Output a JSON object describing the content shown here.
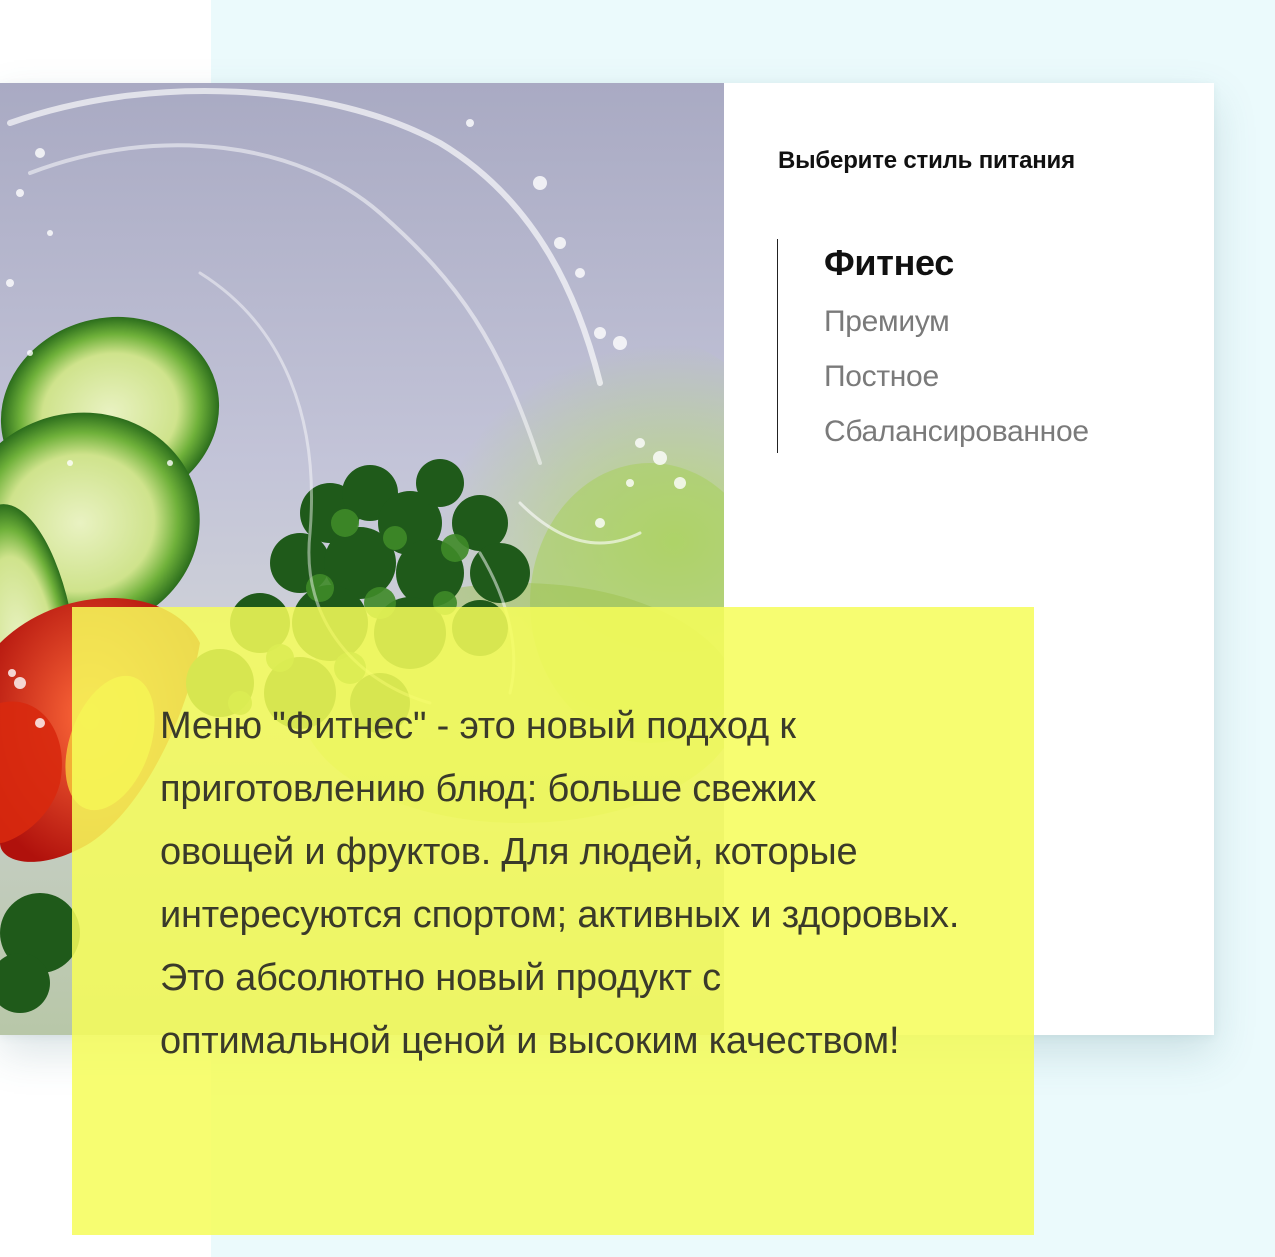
{
  "panel": {
    "title": "Выберите стиль питания",
    "menu_items": [
      {
        "label": "Фитнес",
        "active": true
      },
      {
        "label": "Премиум",
        "active": false
      },
      {
        "label": "Постное",
        "active": false
      },
      {
        "label": "Сбалансированное",
        "active": false
      }
    ]
  },
  "photo": {
    "subject": "salad-vegetables-water-splash-photo"
  },
  "description": {
    "text": "Меню \"Фитнес\" - это новый подход к приготовлению блюд: больше свежих овощей и фруктов. Для людей, которые интересуются спортом; активных и здоровых. Это абсолютно новый продукт с оптимальной ценой и высоким качеством!"
  },
  "colors": {
    "page_tint": "#ebfafc",
    "highlight": "#f6fd5a",
    "active_text": "#111111",
    "inactive_text": "#7a7a7a"
  }
}
